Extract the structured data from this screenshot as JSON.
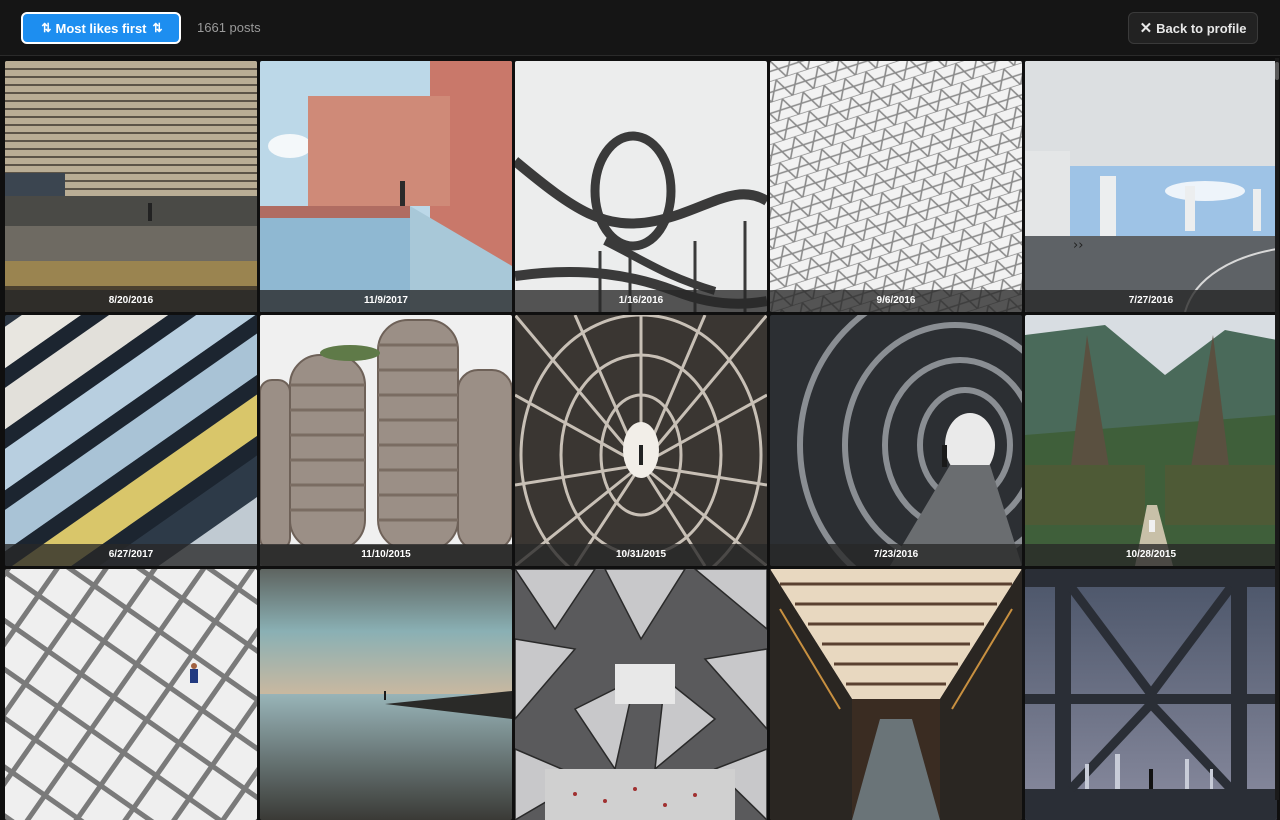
{
  "toolbar": {
    "sort_label": "Most likes first",
    "post_count": "1661 posts",
    "back_label": "Back to profile"
  },
  "colors": {
    "accent": "#1d8ef0",
    "background": "#0f0f0f"
  },
  "posts": [
    {
      "date": "8/20/2016"
    },
    {
      "date": "11/9/2017"
    },
    {
      "date": "1/16/2016"
    },
    {
      "date": "9/6/2016"
    },
    {
      "date": "7/27/2016"
    },
    {
      "date": "6/27/2017"
    },
    {
      "date": "11/10/2015"
    },
    {
      "date": "10/31/2015"
    },
    {
      "date": "7/23/2016"
    },
    {
      "date": "10/28/2015"
    },
    {
      "date": ""
    },
    {
      "date": ""
    },
    {
      "date": ""
    },
    {
      "date": ""
    },
    {
      "date": ""
    }
  ]
}
